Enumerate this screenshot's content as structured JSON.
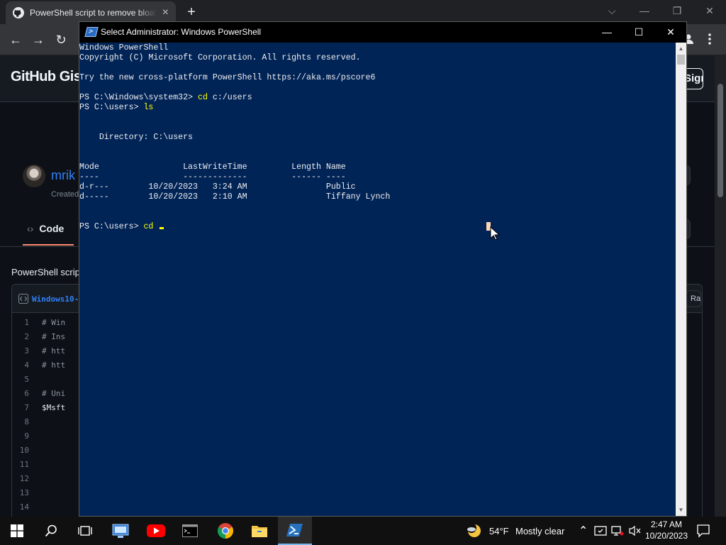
{
  "browser": {
    "tab_title": "PowerShell script to remove bloatware",
    "tab_close": "×",
    "new_tab": "+",
    "nav": {
      "back": "←",
      "forward": "→",
      "reload": "↻"
    },
    "window_controls": {
      "dropdown": "⌵",
      "minimize": "—",
      "restore": "❐",
      "close": "✕"
    }
  },
  "github": {
    "logo_text": "GitHub Gist",
    "signup_label": "Sign up",
    "user": "mrik",
    "created": "Created",
    "code_tab": "Code",
    "code_tab_icon": "‹›",
    "description": "PowerShell script",
    "file_name": "Windows10-",
    "raw_label": "Raw",
    "code_lines": [
      {
        "n": "1",
        "t": "# Win"
      },
      {
        "n": "2",
        "t": "# Ins"
      },
      {
        "n": "3",
        "t": "# htt"
      },
      {
        "n": "4",
        "t": "# htt"
      },
      {
        "n": "5",
        "t": ""
      },
      {
        "n": "6",
        "t": "# Uni"
      },
      {
        "n": "7",
        "t": "$Msft"
      },
      {
        "n": "8",
        "t": ""
      },
      {
        "n": "9",
        "t": ""
      },
      {
        "n": "10",
        "t": ""
      },
      {
        "n": "11",
        "t": ""
      },
      {
        "n": "12",
        "t": ""
      },
      {
        "n": "13",
        "t": ""
      },
      {
        "n": "14",
        "t": ""
      }
    ]
  },
  "powershell": {
    "title": "Select Administrator: Windows PowerShell",
    "controls": {
      "minimize": "—",
      "maximize": "☐",
      "close": "✕"
    },
    "lines": [
      "Windows PowerShell",
      "Copyright (C) Microsoft Corporation. All rights reserved.",
      "",
      "Try the new cross-platform PowerShell https://aka.ms/pscore6",
      "",
      "PS C:\\Windows\\system32> ",
      "PS C:\\users> ",
      "",
      "",
      "    Directory: C:\\users",
      "",
      "",
      "Mode                 LastWriteTime         Length Name",
      "----                 -------------         ------ ----",
      "d-r---        10/20/2023   3:24 AM                Public",
      "d-----        10/20/2023   2:10 AM                Tiffany Lynch",
      "",
      "",
      "PS C:\\users> "
    ],
    "cmd1": {
      "cmd": "cd",
      "arg": " c:/users"
    },
    "cmd2": {
      "cmd": "ls",
      "arg": ""
    },
    "cmd3": {
      "cmd": "cd",
      "arg": " "
    },
    "scroll_up": "▲",
    "scroll_down": "▼"
  },
  "taskbar": {
    "weather_temp": "54°F",
    "weather_text": "Mostly clear",
    "tray_chevron": "⌃",
    "time": "2:47 AM",
    "date": "10/20/2023",
    "notification_icon": "🗨"
  },
  "colors": {
    "ps_background": "#012456",
    "ps_command": "#ffff00",
    "github_link": "#2f81f7",
    "taskbar_active": "#76b9ed"
  }
}
